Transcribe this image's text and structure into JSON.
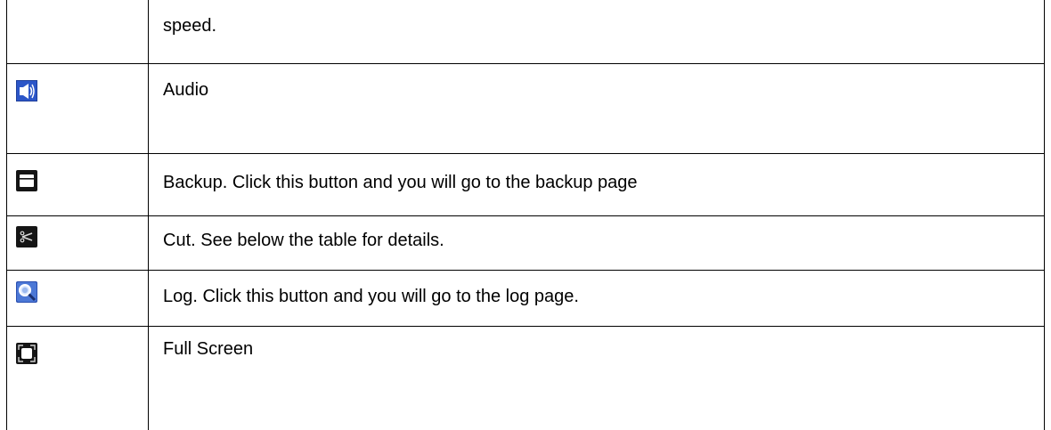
{
  "rows": [
    {
      "icon": "",
      "text": "speed."
    },
    {
      "icon": "audio-speaker-icon",
      "text": "Audio"
    },
    {
      "icon": "backup-folder-icon",
      "text": "Backup. Click this button and you will go to the backup page"
    },
    {
      "icon": "cut-scissors-icon",
      "text": "Cut. See below the table for details."
    },
    {
      "icon": "log-magnifier-icon",
      "text": "Log. Click this button and you will go to the log page."
    },
    {
      "icon": "full-screen-icon",
      "text": "Full Screen"
    }
  ],
  "colors": {
    "border": "#000000",
    "icon_dark": "#151515",
    "audio_blue": "#1f3f9a",
    "log_blue": "#2a4fb0"
  }
}
